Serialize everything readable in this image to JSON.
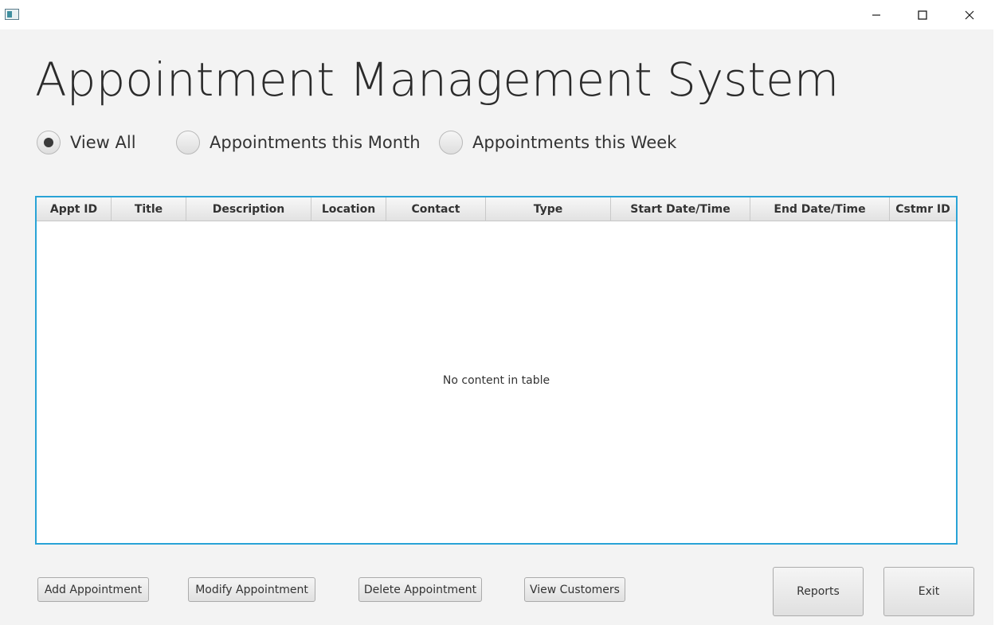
{
  "window": {
    "icons": {
      "app": "app-window-icon",
      "minimize": "minimize-icon",
      "maximize": "maximize-icon",
      "close": "close-icon"
    }
  },
  "header": {
    "title": "Appointment Management System"
  },
  "filters": [
    {
      "label": "View All",
      "selected": true
    },
    {
      "label": "Appointments this Month",
      "selected": false
    },
    {
      "label": "Appointments this Week",
      "selected": false
    }
  ],
  "table": {
    "columns": [
      "Appt ID",
      "Title",
      "Description",
      "Location",
      "Contact",
      "Type",
      "Start Date/Time",
      "End Date/Time",
      "Cstmr ID"
    ],
    "rows": [],
    "placeholder": "No content in table"
  },
  "actions": {
    "add": "Add Appointment",
    "modify": "Modify Appointment",
    "delete": "Delete Appointment",
    "customers": "View Customers",
    "reports": "Reports",
    "exit": "Exit"
  },
  "colors": {
    "accent": "#29a3d6",
    "background": "#f3f3f3"
  }
}
